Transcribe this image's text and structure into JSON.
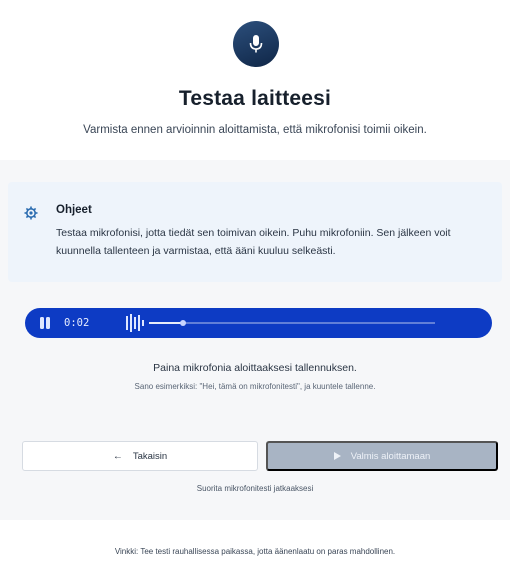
{
  "header": {
    "mic_icon": "microphone-icon",
    "title": "Testaa laitteesi",
    "subtitle": "Varmista ennen arvioinnin aloittamista, että mikrofonisi toimii oikein."
  },
  "instructions": {
    "icon": "gear-icon",
    "title": "Ohjeet",
    "body": "Testaa mikrofonisi, jotta tiedät sen toimivan oikein. Puhu mikrofoniin. Sen jälkeen voit kuunnella tallenteen ja varmistaa, että ääni kuuluu selkeästi."
  },
  "recorder": {
    "time": "0:02",
    "progress": 0.12,
    "accent": "#0d3bc4"
  },
  "hints": {
    "main": "Paina mikrofonia aloittaaksesi tallennuksen.",
    "example": "Sano esimerkiksi: \"Hei, tämä on mikrofonitesti\", ja kuuntele tallenne."
  },
  "actions": {
    "back_label": "Takaisin",
    "ready_label": "Valmis aloittamaan",
    "help_text": "Suorita mikrofonitesti jatkaaksesi"
  },
  "footer": {
    "tip": "Vinkki: Tee testi rauhallisessa paikassa, jotta äänenlaatu on paras mahdollinen."
  }
}
